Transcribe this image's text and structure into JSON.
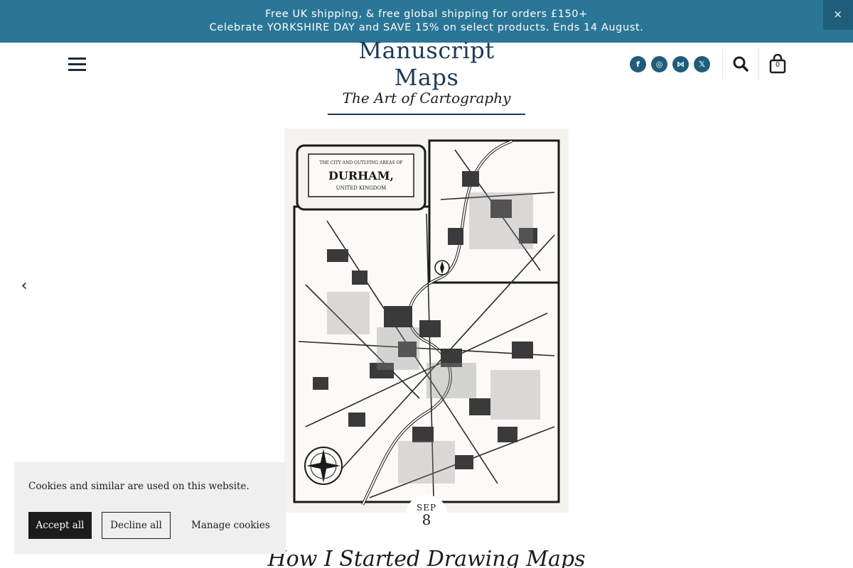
{
  "announcement": {
    "line1": "Free UK shipping, & free global shipping for orders £150+",
    "line2": "Celebrate YORKSHIRE DAY and SAVE 15% on select products. Ends 14 August.",
    "close_label": "×"
  },
  "header": {
    "logo_title": "Manuscript Maps",
    "logo_tagline": "The Art of Cartography",
    "social": [
      {
        "name": "facebook-icon",
        "glyph": "f"
      },
      {
        "name": "instagram-icon",
        "glyph": "◎"
      },
      {
        "name": "bluesky-icon",
        "glyph": "⋈"
      },
      {
        "name": "x-twitter-icon",
        "glyph": "𝕏"
      }
    ],
    "cart_count": "0"
  },
  "hero": {
    "prev_arrow": "‹",
    "map_cartouche_top": "THE CITY AND OUTLYING AREAS OF",
    "map_cartouche_title": "DURHAM,",
    "map_cartouche_sub": "UNITED KINGDOM",
    "date_month": "SEP",
    "date_day": "8",
    "post_title": "How I Started Drawing Maps"
  },
  "cookie_banner": {
    "message": "Cookies and similar are used on this website.",
    "accept_label": "Accept all",
    "decline_label": "Decline all",
    "manage_label": "Manage cookies"
  },
  "colors": {
    "brand_bar": "#2a7696",
    "brand_dark": "#1f5e7a",
    "text": "#1c1c1c"
  }
}
